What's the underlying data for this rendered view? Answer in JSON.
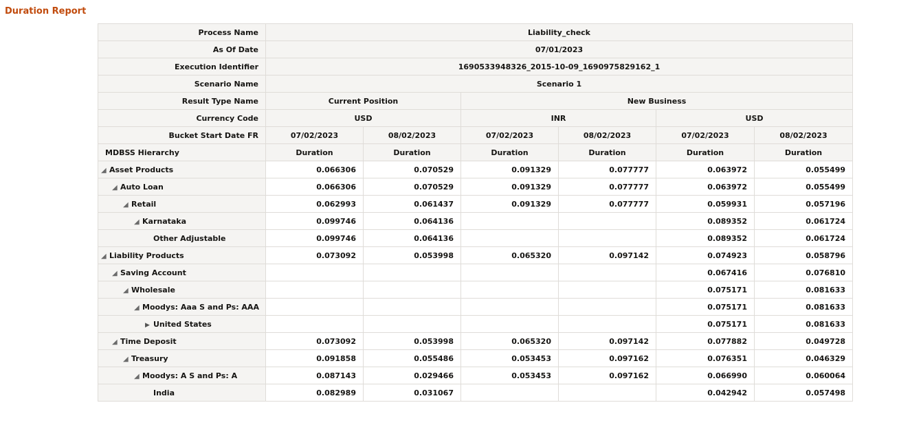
{
  "title": "Duration Report",
  "meta": {
    "process_name_label": "Process Name",
    "process_name": "Liability_check",
    "as_of_date_label": "As Of Date",
    "as_of_date": "07/01/2023",
    "execution_identifier_label": "Execution Identifier",
    "execution_identifier": "1690533948326_2015-10-09_1690975829162_1",
    "scenario_name_label": "Scenario Name",
    "scenario_name": "Scenario 1",
    "result_type_label": "Result Type Name",
    "result_type_1": "Current Position",
    "result_type_2": "New Business",
    "currency_code_label": "Currency Code",
    "currency_1": "USD",
    "currency_2": "INR",
    "currency_3": "USD",
    "bucket_label": "Bucket Start Date FR",
    "buckets": [
      "07/02/2023",
      "08/02/2023",
      "07/02/2023",
      "08/02/2023",
      "07/02/2023",
      "08/02/2023"
    ],
    "hierarchy_label": "MDBSS Hierarchy",
    "measure": "Duration"
  },
  "rows": [
    {
      "label": "Asset Products",
      "values": [
        "0.066306",
        "0.070529",
        "0.091329",
        "0.077777",
        "0.063972",
        "0.055499"
      ]
    },
    {
      "label": "Auto Loan",
      "values": [
        "0.066306",
        "0.070529",
        "0.091329",
        "0.077777",
        "0.063972",
        "0.055499"
      ]
    },
    {
      "label": "Retail",
      "values": [
        "0.062993",
        "0.061437",
        "0.091329",
        "0.077777",
        "0.059931",
        "0.057196"
      ]
    },
    {
      "label": "Karnataka",
      "values": [
        "0.099746",
        "0.064136",
        "",
        "",
        "0.089352",
        "0.061724"
      ]
    },
    {
      "label": "Other Adjustable",
      "values": [
        "0.099746",
        "0.064136",
        "",
        "",
        "0.089352",
        "0.061724"
      ]
    },
    {
      "label": "Liability Products",
      "values": [
        "0.073092",
        "0.053998",
        "0.065320",
        "0.097142",
        "0.074923",
        "0.058796"
      ]
    },
    {
      "label": "Saving Account",
      "values": [
        "",
        "",
        "",
        "",
        "0.067416",
        "0.076810"
      ]
    },
    {
      "label": "Wholesale",
      "values": [
        "",
        "",
        "",
        "",
        "0.075171",
        "0.081633"
      ]
    },
    {
      "label": "Moodys: Aaa S and Ps: AAA",
      "values": [
        "",
        "",
        "",
        "",
        "0.075171",
        "0.081633"
      ]
    },
    {
      "label": "United States",
      "values": [
        "",
        "",
        "",
        "",
        "0.075171",
        "0.081633"
      ]
    },
    {
      "label": "Time Deposit",
      "values": [
        "0.073092",
        "0.053998",
        "0.065320",
        "0.097142",
        "0.077882",
        "0.049728"
      ]
    },
    {
      "label": "Treasury",
      "values": [
        "0.091858",
        "0.055486",
        "0.053453",
        "0.097162",
        "0.076351",
        "0.046329"
      ]
    },
    {
      "label": "Moodys: A S and Ps: A",
      "values": [
        "0.087143",
        "0.029466",
        "0.053453",
        "0.097162",
        "0.066990",
        "0.060064"
      ]
    },
    {
      "label": "India",
      "values": [
        "0.082989",
        "0.031067",
        "",
        "",
        "0.042942",
        "0.057498"
      ]
    }
  ]
}
